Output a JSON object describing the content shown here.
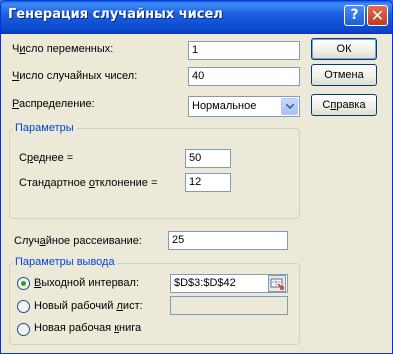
{
  "window": {
    "title": "Генерация случайных чисел",
    "help_glyph": "?",
    "close_glyph": "✕"
  },
  "fields": {
    "num_vars_label_pre": "Ч",
    "num_vars_label_u": "и",
    "num_vars_label_post": "сло переменных:",
    "num_vars_value": "1",
    "num_rand_label_u": "Ч",
    "num_rand_label_post": "исло случайных чисел:",
    "num_rand_value": "40",
    "dist_label_u": "Р",
    "dist_label_post": "аспределение:",
    "dist_value": "Нормальное"
  },
  "buttons": {
    "ok": "ОК",
    "cancel": "Отмена",
    "help_pre": "С",
    "help_u": "п",
    "help_post": "равка"
  },
  "params": {
    "title": "Параметры",
    "mean_label_pre": "С",
    "mean_label_u": "р",
    "mean_label_post": "еднее =",
    "mean_value": "50",
    "std_label_pre": "Стандартное ",
    "std_label_u": "о",
    "std_label_post": "тклонение =",
    "std_value": "12"
  },
  "seed": {
    "label_pre": "Случ",
    "label_u": "а",
    "label_post": "йное рассеивание:",
    "value": "25"
  },
  "output": {
    "title": "Параметры вывода",
    "range_label_u": "В",
    "range_label_post": "ыходной интервал:",
    "range_value": "$D$3:$D$42",
    "range_selected": true,
    "new_sheet_label_pre": "Новый рабочий ",
    "new_sheet_label_u": "л",
    "new_sheet_label_post": "ист:",
    "new_sheet_value": "",
    "new_book_label_pre": "Новая рабочая ",
    "new_book_label_u": "к",
    "new_book_label_post": "нига"
  }
}
